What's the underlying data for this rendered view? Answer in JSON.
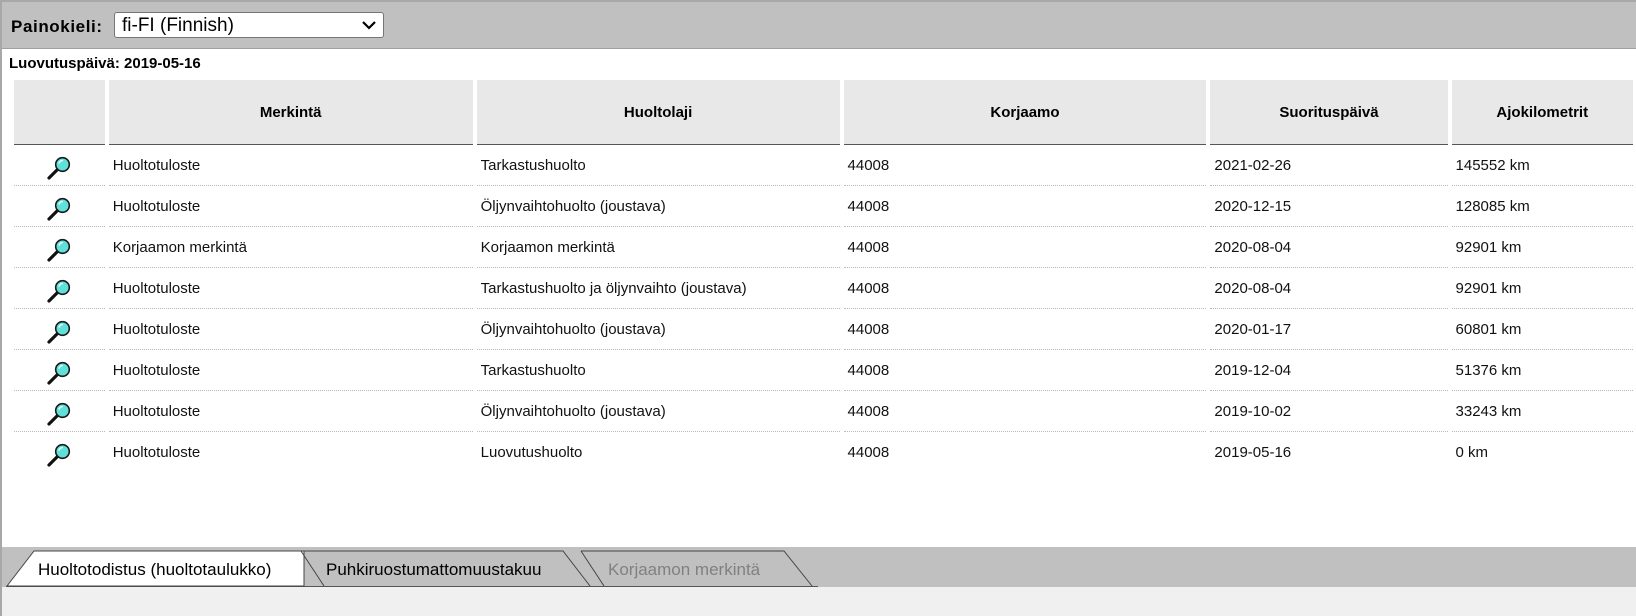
{
  "header": {
    "language_label": "Painokieli:",
    "language_value": "fi-FI (Finnish)"
  },
  "release_date_text": "Luovutuspäivä: 2019-05-16",
  "table": {
    "columns": [
      "",
      "Merkintä",
      "Huoltolaji",
      "Korjaamo",
      "Suorituspäivä",
      "Ajokilometrit"
    ],
    "rows": [
      {
        "merkinta": "Huoltotuloste",
        "huoltolaji": "Tarkastushuolto",
        "korjaamo": "44008",
        "paiva": "2021-02-26",
        "km": "145552 km"
      },
      {
        "merkinta": "Huoltotuloste",
        "huoltolaji": "Öljynvaihtohuolto (joustava)",
        "korjaamo": "44008",
        "paiva": "2020-12-15",
        "km": "128085 km"
      },
      {
        "merkinta": "Korjaamon merkintä",
        "huoltolaji": "Korjaamon merkintä",
        "korjaamo": "44008",
        "paiva": "2020-08-04",
        "km": "92901 km"
      },
      {
        "merkinta": "Huoltotuloste",
        "huoltolaji": "Tarkastushuolto ja öljynvaihto (joustava)",
        "korjaamo": "44008",
        "paiva": "2020-08-04",
        "km": "92901 km"
      },
      {
        "merkinta": "Huoltotuloste",
        "huoltolaji": "Öljynvaihtohuolto (joustava)",
        "korjaamo": "44008",
        "paiva": "2020-01-17",
        "km": "60801 km"
      },
      {
        "merkinta": "Huoltotuloste",
        "huoltolaji": "Tarkastushuolto",
        "korjaamo": "44008",
        "paiva": "2019-12-04",
        "km": "51376 km"
      },
      {
        "merkinta": "Huoltotuloste",
        "huoltolaji": "Öljynvaihtohuolto (joustava)",
        "korjaamo": "44008",
        "paiva": "2019-10-02",
        "km": "33243 km"
      },
      {
        "merkinta": "Huoltotuloste",
        "huoltolaji": "Luovutushuolto",
        "korjaamo": "44008",
        "paiva": "2019-05-16",
        "km": "0 km"
      }
    ],
    "row_icon": "magnifier-icon"
  },
  "tabs": [
    {
      "label": "Huoltotodistus (huoltotaulukko)",
      "state": "active"
    },
    {
      "label": "Puhkiruostumattomuustakuu",
      "state": "normal"
    },
    {
      "label": "Korjaamon merkintä",
      "state": "disabled"
    }
  ],
  "colors": {
    "toolbar_bg": "#c0c0c0",
    "header_bg": "#e8e8e8",
    "tab_disabled_text": "#808080",
    "magnifier_lens": "#5fe0d8"
  }
}
